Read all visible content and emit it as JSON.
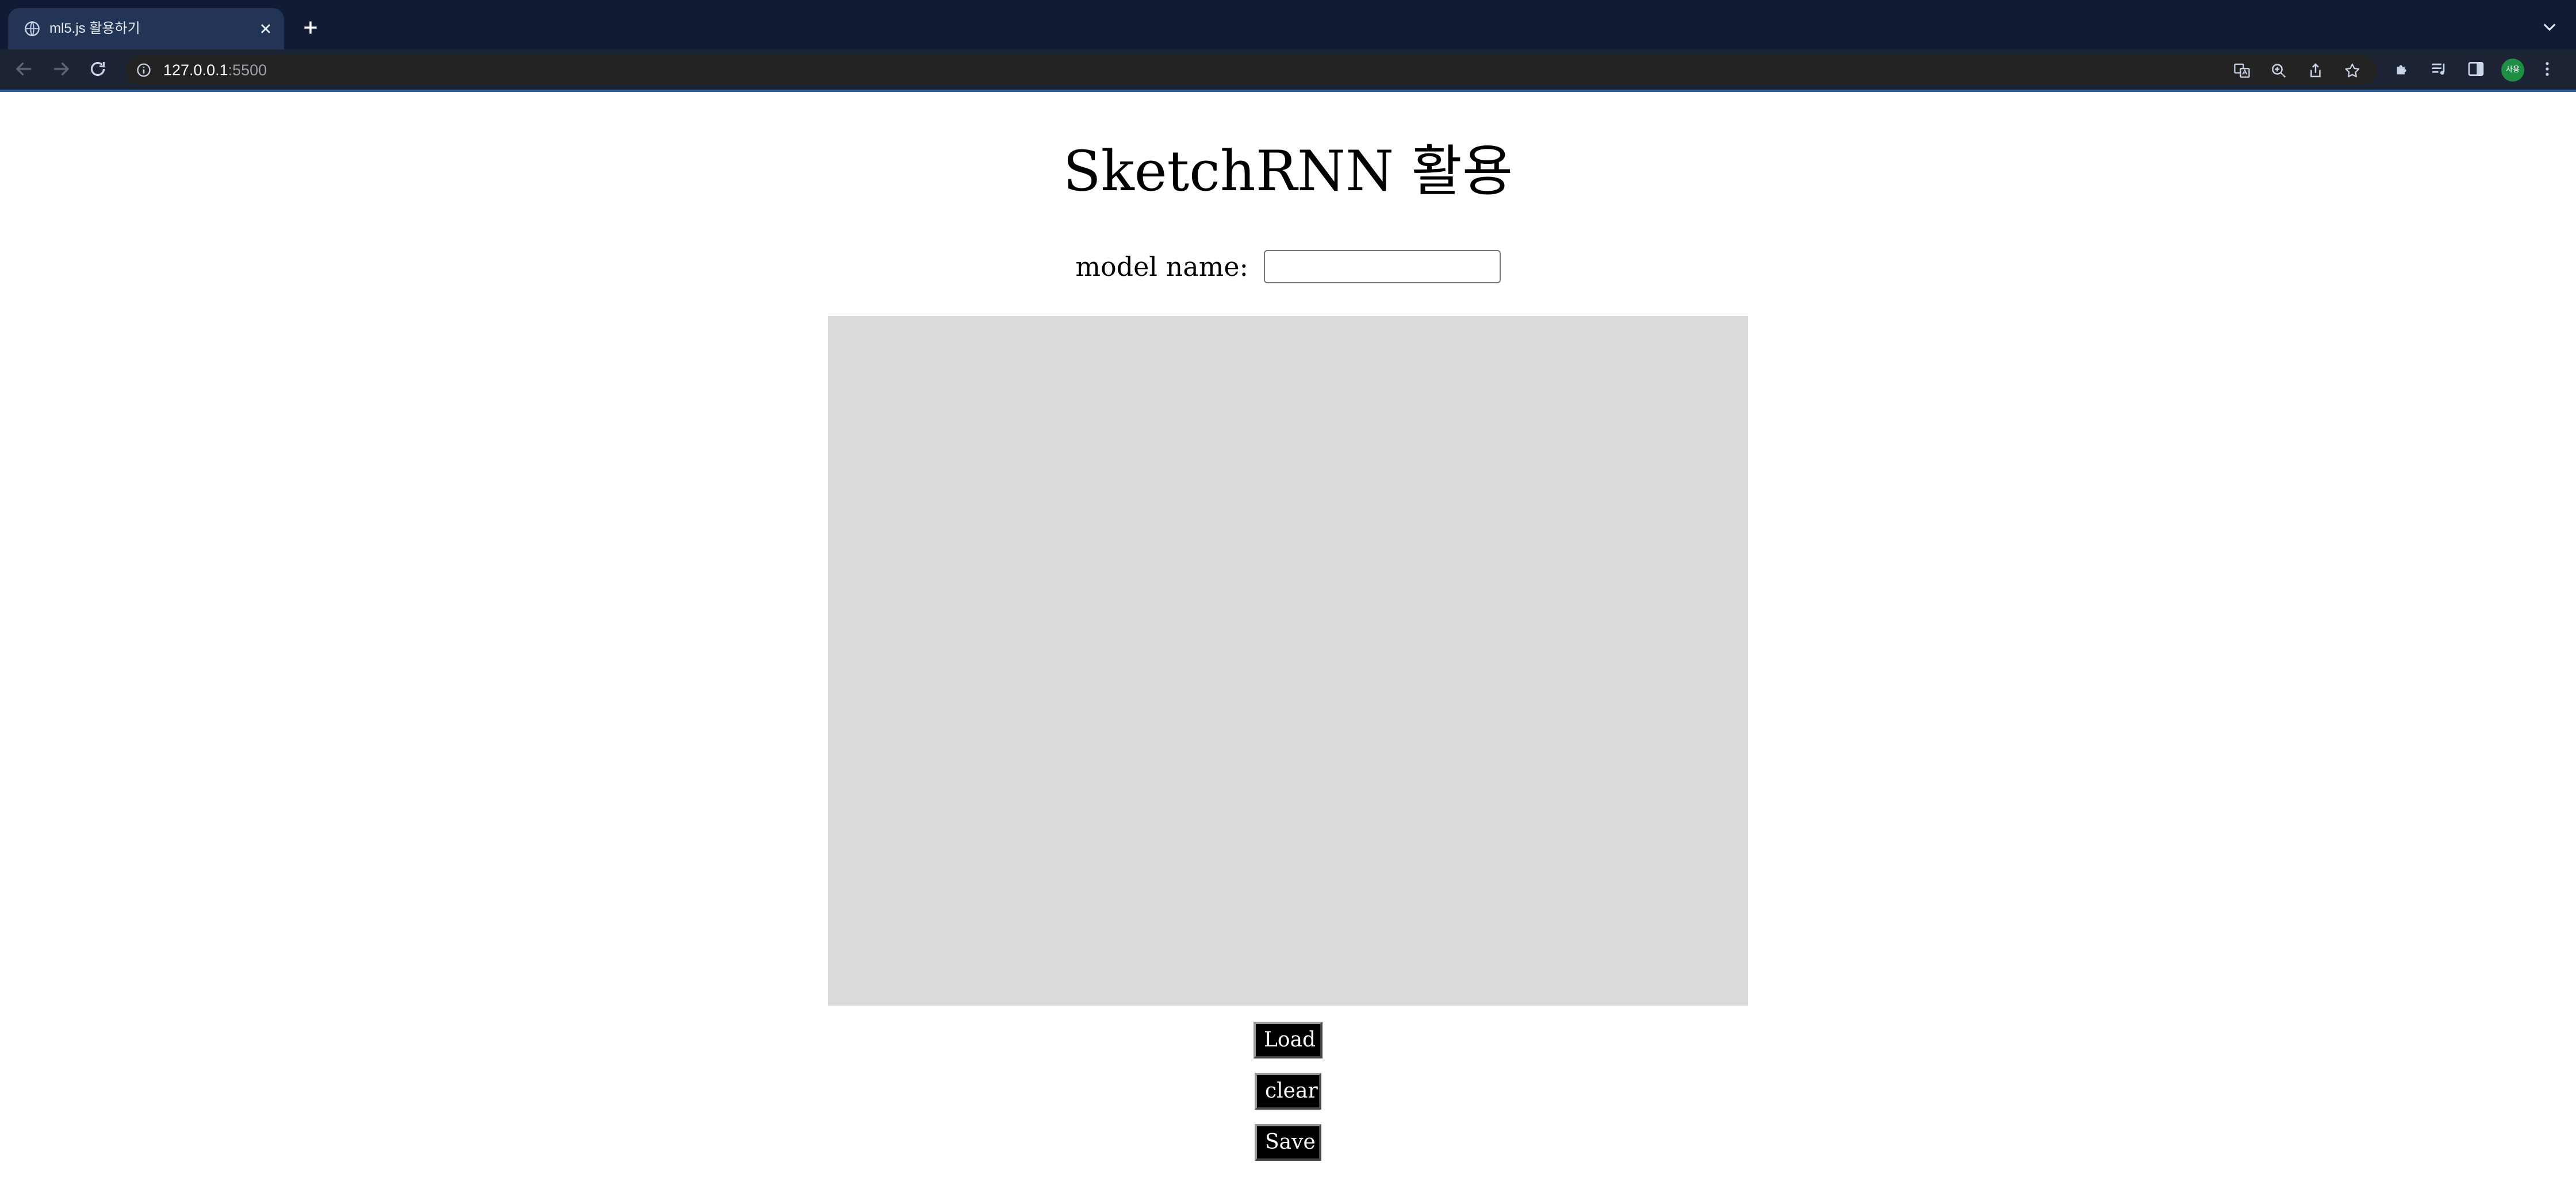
{
  "browser": {
    "tab_title": "ml5.js 활용하기",
    "url_host": "127.0.0.1",
    "url_port": ":5500",
    "profile_label": "사용"
  },
  "page": {
    "title": "SketchRNN 활용",
    "model_label": "model name:",
    "model_value": "",
    "buttons": {
      "load": "Load",
      "clear": "clear",
      "save": "Save"
    }
  },
  "colors": {
    "tabbar": "#111b33",
    "canvas": "#dcdcdc",
    "button_bg": "#000000"
  }
}
